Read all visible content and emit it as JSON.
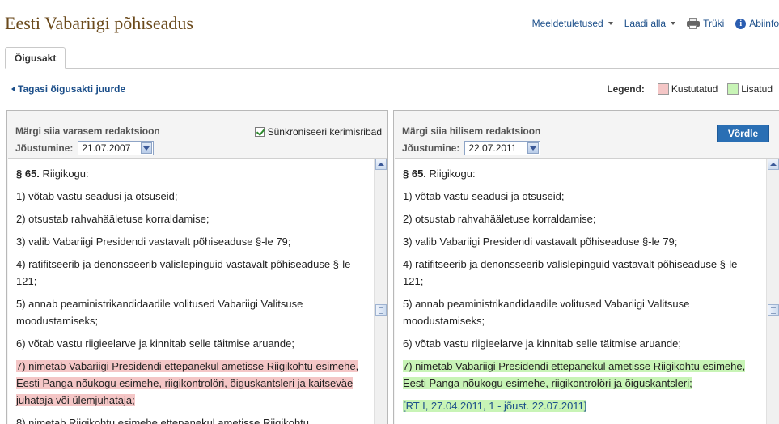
{
  "header": {
    "title": "Eesti Vabariigi põhiseadus",
    "nav": {
      "reminders": "Meeldetuletused",
      "download": "Laadi alla",
      "print": "Trüki",
      "help": "Abiinfo"
    }
  },
  "tabs": [
    {
      "label": "Õigusakt",
      "active": true
    }
  ],
  "back_link": "Tagasi õigusakti juurde",
  "legend": {
    "label": "Legend:",
    "deleted": {
      "label": "Kustutatud",
      "color": "#f4c6c6"
    },
    "added": {
      "label": "Lisatud",
      "color": "#c8f4b6"
    }
  },
  "left_panel": {
    "title": "Märgi siia varasem redaktsioon",
    "date_label": "Jõustumine:",
    "date_value": "21.07.2007",
    "sync_label": "Sünkroniseeri kerimisribad",
    "sync_checked": true,
    "paragraph_head": "§ 65.",
    "paragraph_body": " Riigikogu:",
    "items": [
      "1) võtab vastu seadusi ja otsuseid;",
      "2) otsustab rahvahääletuse korraldamise;",
      "3) valib Vabariigi Presidendi vastavalt põhiseaduse §-le 79;",
      "4) ratifitseerib ja denonsseerib välislepinguid vastavalt põhiseaduse §-le 121;",
      "5) annab peaministrikandidaadile volitused Vabariigi Valitsuse moodustamiseks;",
      "6) võtab vastu riigieelarve ja kinnitab selle täitmise aruande;"
    ],
    "changed_item": "7) nimetab Vabariigi Presidendi ettepanekul ametisse Riigikohtu esimehe, Eesti Panga nõukogu esimehe, riigikontrolöri, õiguskantsleri ja kaitseväe juhataja või ülemjuhataja;",
    "next_item_partial": "8) nimetab Riigikohtu esimehe ettepanekul ametisse Riigikohtu"
  },
  "right_panel": {
    "title": "Märgi siia hilisem redaktsioon",
    "date_label": "Jõustumine:",
    "date_value": "22.07.2011",
    "compare_button": "Võrdle",
    "paragraph_head": "§ 65.",
    "paragraph_body": " Riigikogu:",
    "items": [
      "1) võtab vastu seadusi ja otsuseid;",
      "2) otsustab rahvahääletuse korraldamise;",
      "3) valib Vabariigi Presidendi vastavalt põhiseaduse §-le 79;",
      "4) ratifitseerib ja denonsseerib välislepinguid vastavalt põhiseaduse §-le 121;",
      "5) annab peaministrikandidaadile volitused Vabariigi Valitsuse moodustamiseks;",
      "6) võtab vastu riigieelarve ja kinnitab selle täitmise aruande;"
    ],
    "changed_item": "7) nimetab Vabariigi Presidendi ettepanekul ametisse Riigikohtu esimehe, Eesti Panga nõukogu esimehe, riigikontrolöri ja õiguskantsleri;",
    "ref_partial": "[RT I, 27.04.2011, 1 - jõust. 22.07.2011]"
  }
}
